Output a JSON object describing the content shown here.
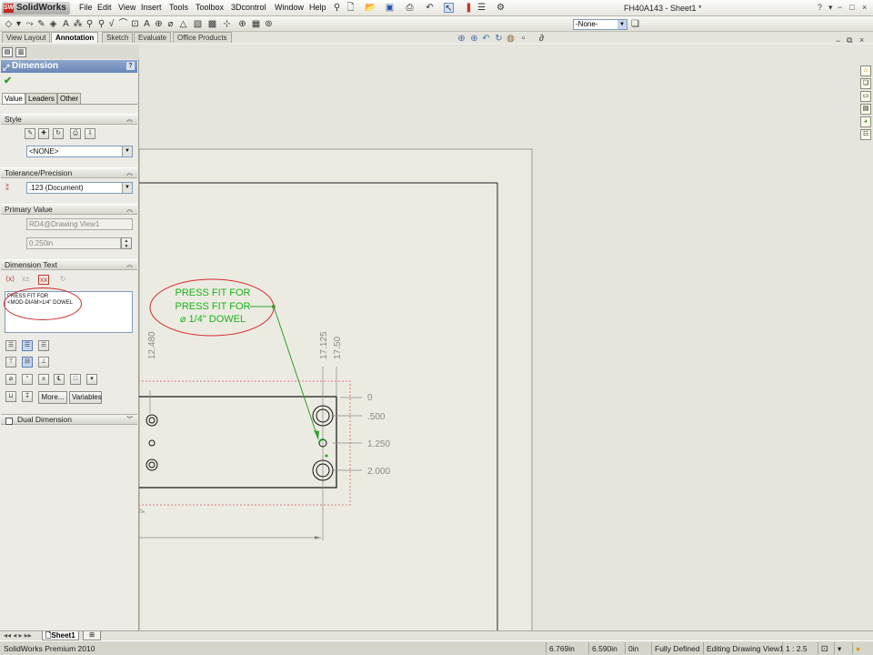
{
  "app": {
    "logo": "SolidWorks",
    "document_title": "FH40A143 - Sheet1 *",
    "menus": [
      "File",
      "Edit",
      "View",
      "Insert",
      "Tools",
      "Toolbox",
      "3Dcontrol",
      "Window",
      "Help"
    ],
    "window_controls": [
      "?",
      "−",
      "□",
      "×"
    ],
    "layer_select": "-None-"
  },
  "command_tabs": [
    "View Layout",
    "Annotation",
    "Sketch",
    "Evaluate",
    "Office Products"
  ],
  "property_manager": {
    "title": "Dimension",
    "help": "?",
    "subtabs": [
      "Value",
      "Leaders",
      "Other"
    ],
    "style": {
      "header": "Style",
      "select": "<NONE>"
    },
    "tolerance": {
      "header": "Tolerance/Precision",
      "select": ".123 (Document)"
    },
    "primary_value": {
      "header": "Primary Value",
      "reference": "RD4@Drawing View1",
      "value": "0.250in"
    },
    "dimension_text": {
      "header": "Dimension Text",
      "text_line1": "PRESS FIT  FOR",
      "text_line2": "<MOD-DIAM>1/4\" DOWEL",
      "more_button": "More...",
      "variables_button": "Variables"
    },
    "dual_dimension": "Dual Dimension"
  },
  "drawing": {
    "note_line1": "PRESS FIT  FOR",
    "note_line2": "PRESS FIT  FOR",
    "note_line3": "⌀ 1/4\" DOWEL",
    "dims_vertical": [
      "12.480",
      "17.125",
      "17.50"
    ],
    "dims_horizontal": [
      "0",
      ".500",
      "1.250",
      "2.000"
    ],
    "colors": {
      "note_text": "#19b419",
      "leader": "#2aa22a",
      "callout_ellipse": "#d42a2a",
      "dim_lines": "#8a8a86",
      "sheet": "#ecebe2"
    }
  },
  "sheet_tabs": [
    "Sheet1"
  ],
  "status_bar": {
    "product": "SolidWorks Premium 2010",
    "x": "6.769in",
    "y": "6.590in",
    "z": "0in",
    "state": "Fully Defined",
    "mode": "Editing Drawing View1",
    "scale": "1 : 2.5"
  }
}
